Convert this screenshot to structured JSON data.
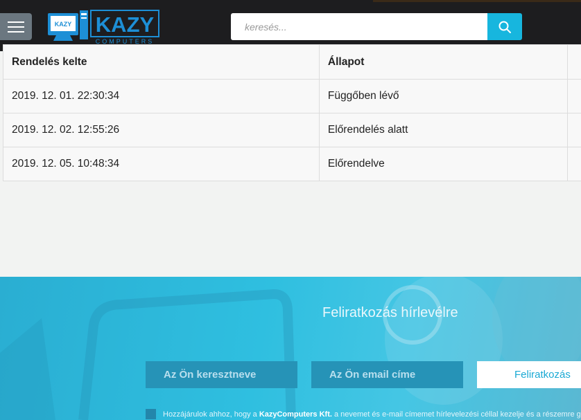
{
  "header": {
    "logo_text": "KAZY",
    "logo_subtext": "COMPUTERS",
    "logo_badge": "KAZY",
    "search": {
      "placeholder": "keresés...",
      "value": ""
    }
  },
  "orders_table": {
    "columns": [
      "Rendelés kelte",
      "Állapot",
      ""
    ],
    "rows": [
      {
        "date": "2019. 12. 01. 22:30:34",
        "status": "Függőben lévő"
      },
      {
        "date": "2019. 12. 02. 12:55:26",
        "status": "Előrendelés alatt"
      },
      {
        "date": "2019. 12. 05. 10:48:34",
        "status": "Előrendelve"
      }
    ]
  },
  "newsletter": {
    "title": "Feliratkozás hírlevélre",
    "firstname_placeholder": "Az Ön keresztneve",
    "email_placeholder": "Az Ön email címe",
    "submit_label": "Feliratkozás",
    "consent_prefix": "Hozzájárulok ahhoz, hogy a ",
    "consent_company": "KazyComputers Kft.",
    "consent_suffix": " a nevemet és e-mail címemet hírlevelezési céllal kezelje és a részemre gazdaság"
  },
  "colors": {
    "header_bg": "#1d1d1f",
    "accent": "#17b6de",
    "logo_blue": "#1d8fd6",
    "newsletter_bg": "#2fbfe0"
  }
}
